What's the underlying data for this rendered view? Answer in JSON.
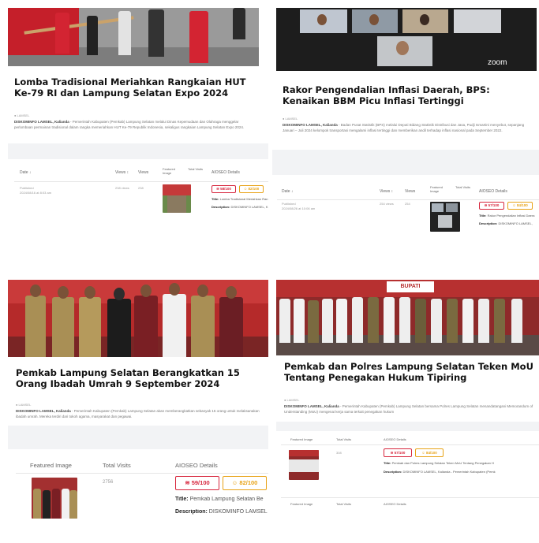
{
  "cards": [
    {
      "title": "Lomba Tradisional Meriahkan Rangkaian HUT Ke-79 RI dan Lampung Selatan Expo 2024",
      "meta": "● LAMSEL",
      "excerpt_source": "DISKOMINFO LAMSEL, Kalianda",
      "excerpt": " - Pemerintah Kabupaten (Pemkab) Lampung Selatan melalui Dinas Kepemudaan dan Olahraga menggelar perlombaan permainan tradisional dalam rangka memeriahkan HUT Ke-79 Republik Indonesia, sekaligus rangkaian Lampung Selatan Expo 2024."
    },
    {
      "title": "Rakor Pengendalian Inflasi Daerah, BPS: Kenaikan BBM Picu Inflasi Tertinggi",
      "meta": "● LAMSEL",
      "excerpt_source": "DISKOMINFO LAMSEL, Kalianda",
      "excerpt": " - Badan Pusat Statistik (BPS) melalui Deputi Bidang Statistik Distribusi dan Jasa, Pudji Ismartini menyebut, sepanjang Januari – Juli 2024 kelompok transportasi mengalami inflasi tertinggi dan memberikan andil terhadap inflasi nasional pada September 2022.",
      "zoom_label": "zoom"
    },
    {
      "title": "Pemkab Lampung Selatan Berangkatkan 15 Orang Ibadah Umrah 9 September 2024",
      "meta": "● LAMSEL",
      "excerpt_source": "DISKOMINFO LAMSEL, Kalianda",
      "excerpt": " - Pemerintah Kabupaten (Pemkab) Lampung Selatan akan memberangkatkan sebanyak 15 orang untuk melaksanakan ibadah umrah. Mereka terdiri dari tokoh agama, masyarakat dan pegawai."
    },
    {
      "title": "Pemkab dan Polres Lampung Selatan Teken MoU Tentang Penegakan Hukum Tipiring",
      "meta": "● LAMSEL",
      "excerpt_source": "DISKOMINFO LAMSEL, Kalianda",
      "excerpt": " - Pemerintah Kabupaten (Pemkab) Lampung Selatan bersama Polres Lampung Selatan menandatangani Memorandum of Understanding (MoU) mengenai kerja sama terkait penegakan hukum",
      "banner_label": "BUPATI"
    }
  ],
  "tables": [
    {
      "headers": [
        "Date ↓",
        "Views ↕",
        "Views",
        "Featured Image",
        "Total Visits",
        "AIOSEO Details"
      ],
      "date": "Published\n2024/08/16 at 8:03 am",
      "views_a": "238 views",
      "views_b": "238",
      "seo": "58/100",
      "read": "82/100",
      "title_label": "Title:",
      "title_value": "Lomba Tradisional Meriahkan Ran",
      "desc_label": "Description:",
      "desc_value": "DISKOMINFO LAMSEL, K"
    },
    {
      "headers": [
        "Date ↓",
        "Views ↕",
        "Views",
        "Featured Image",
        "Total Visits",
        "AIOSEO Details"
      ],
      "date": "Published\n2024/08/26 at 10:06 am",
      "views_a": "254 views",
      "views_b": "254",
      "seo": "57/100",
      "read": "84/100",
      "title_label": "Title:",
      "title_value": "Rakor Pengendalian Inflasi Daera",
      "desc_label": "Description:",
      "desc_value": "DISKOMINFO LAMSEL,"
    },
    {
      "headers": [
        "Featured Image",
        "Total Visits",
        "AIOSEO Details"
      ],
      "visits": "2756",
      "seo": "59/100",
      "read": "82/100",
      "title_label": "Title:",
      "title_value": "Pemkab Lampung Selatan Be",
      "desc_label": "Description:",
      "desc_value": "DISKOMINFO LAMSEL"
    },
    {
      "headers": [
        "Featured Image",
        "Total Visits",
        "AIOSEO Details"
      ],
      "visits": "308",
      "seo": "57/100",
      "read": "84/100",
      "title_label": "Title:",
      "title_value": "Pemkab dan Polres Lampung Selatan Teken MoU Tentang Penegakan H",
      "desc_label": "Description:",
      "desc_value": "DISKOMINFO LAMSEL, Kalianda - Pemerintah Kabupaten (Pemk",
      "footer_headers": [
        "Featured Image",
        "Total Visits",
        "AIOSEO Details"
      ]
    }
  ],
  "seo_icon": "≋",
  "read_icon": "☺",
  "colors": {
    "seo": "#d7263d",
    "read": "#e8a317",
    "brand_red": "#c81e2c"
  }
}
